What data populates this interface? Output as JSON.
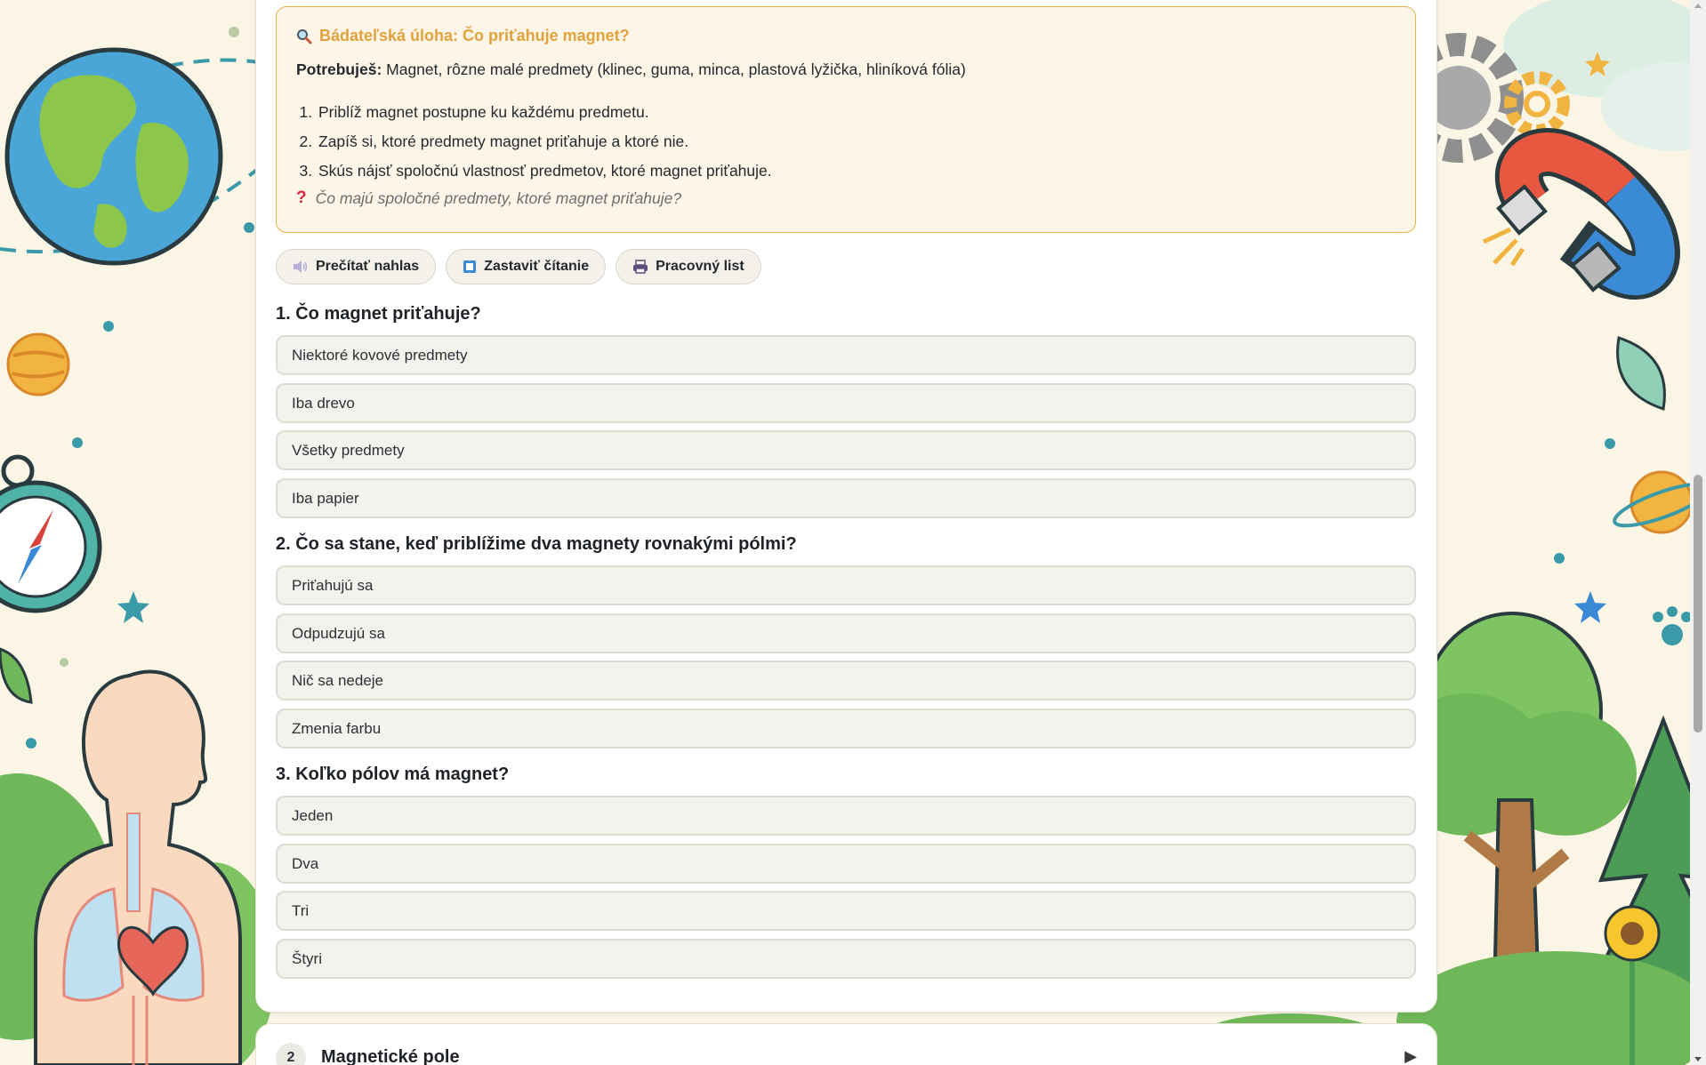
{
  "colors": {
    "accent": "#e2a23b",
    "task_bg": "#fdf5e7",
    "task_border": "#e8b34b",
    "option_bg": "#f3f2ec",
    "option_border": "#dcdcd2",
    "page_bg": "#fbf5e6"
  },
  "task": {
    "icon": "magnifier-icon",
    "title": "Bádateľská úloha: Čo priťahuje magnet?",
    "needs_label": "Potrebuješ:",
    "needs_text": " Magnet, rôzne malé predmety (klinec, guma, minca, plastová lyžička, hliníková fólia)",
    "steps": [
      "Priblíž magnet postupne ku každému predmetu.",
      "Zapíš si, ktoré predmety magnet priťahuje a ktoré nie.",
      "Skús nájsť spoločnú vlastnosť predmetov, ktoré magnet priťahuje."
    ],
    "question_icon": "question-mark-icon",
    "question_mark": "?",
    "question": "Čo majú spoločné predmety, ktoré magnet priťahuje?"
  },
  "toolbar": {
    "read_aloud": "Prečítať nahlas",
    "stop_reading": "Zastaviť čítanie",
    "worksheet": "Pracovný list"
  },
  "quiz": [
    {
      "question": "1. Čo magnet priťahuje?",
      "options": [
        "Niektoré kovové predmety",
        "Iba drevo",
        "Všetky predmety",
        "Iba papier"
      ]
    },
    {
      "question": "2. Čo sa stane, keď priblížime dva magnety rovnakými pólmi?",
      "options": [
        "Priťahujú sa",
        "Odpudzujú sa",
        "Nič sa nedeje",
        "Zmenia farbu"
      ]
    },
    {
      "question": "3. Koľko pólov má magnet?",
      "options": [
        "Jeden",
        "Dva",
        "Tri",
        "Štyri"
      ]
    }
  ],
  "next_section": {
    "number": "2",
    "title": "Magnetické pole",
    "arrow": "▶"
  }
}
